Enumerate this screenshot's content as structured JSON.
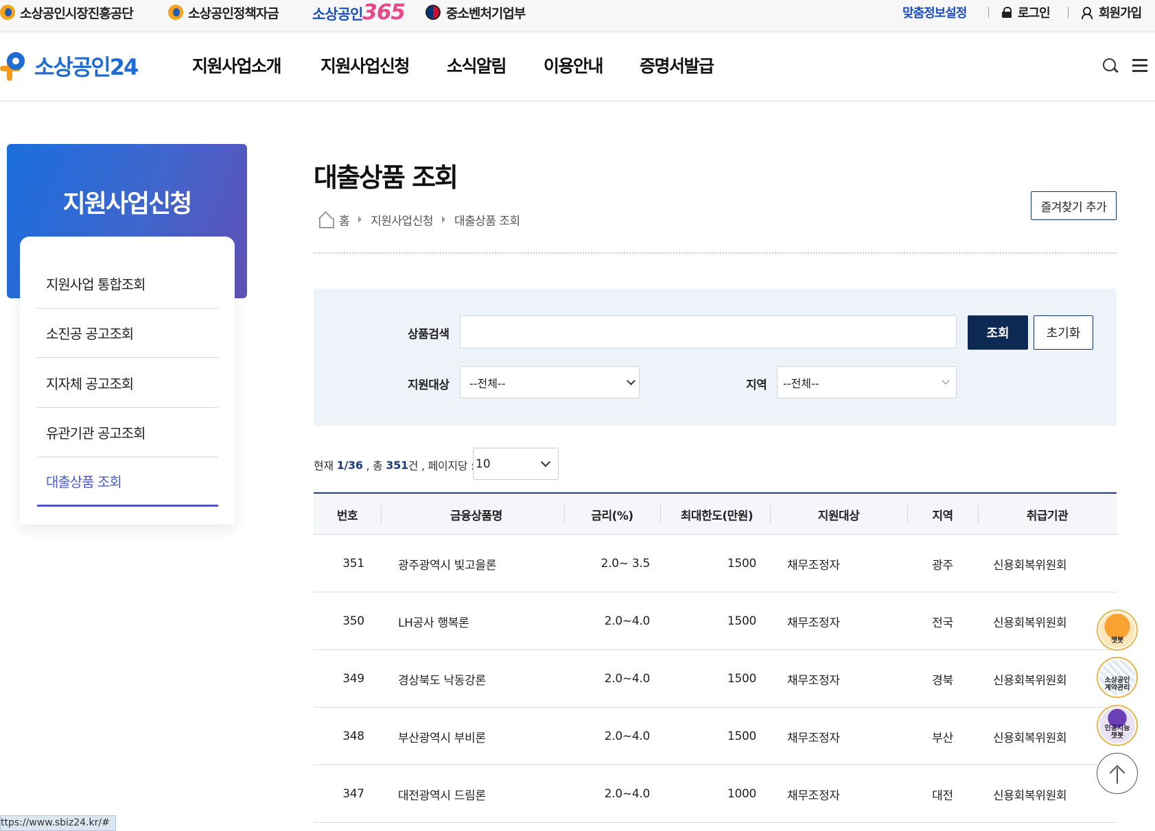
{
  "topbar": {
    "org1": "소상공인시장진흥공단",
    "org2": "소상공인정책자금",
    "org3_text": "소상공인",
    "org3_num": "365",
    "org4": "중소벤처기업부",
    "custom_info": "맞춤정보설정",
    "login": "로그인",
    "signup": "회원가입"
  },
  "header": {
    "brand": "소상공인24",
    "nav": [
      "지원사업소개",
      "지원사업신청",
      "소식알림",
      "이용안내",
      "증명서발급"
    ]
  },
  "sidebar": {
    "title": "지원사업신청",
    "items": [
      "지원사업 통합조회",
      "소진공 공고조회",
      "지자체 공고조회",
      "유관기관 공고조회",
      "대출상품 조회"
    ],
    "active_index": 4
  },
  "page": {
    "title": "대출상품 조회",
    "breadcrumb": [
      "홈",
      "지원사업신청",
      "대출상품 조회"
    ],
    "favorite_button": "즐겨찾기 추가"
  },
  "search": {
    "product_label": "상품검색",
    "product_value": "",
    "search_button": "조회",
    "reset_button": "초기화",
    "target_label": "지원대상",
    "target_value": "--전체--",
    "region_label": "지역",
    "region_value": "--전체--"
  },
  "summary": {
    "current_label": "현재",
    "page": "1/36",
    "total_label": ", 총",
    "total": "351",
    "unit": "건",
    "per_page_label": ", 페이지당 :",
    "per_page": "10"
  },
  "table": {
    "headers": [
      "번호",
      "금융상품명",
      "금리(%)",
      "최대한도(만원)",
      "지원대상",
      "지역",
      "취급기관"
    ],
    "rows": [
      {
        "no": "351",
        "name": "광주광역시 빛고을론",
        "rate": "2.0~ 3.5",
        "limit": "1500",
        "target": "채무조정자",
        "region": "광주",
        "agency": "신용회복위원회"
      },
      {
        "no": "350",
        "name": "LH공사 행복론",
        "rate": "2.0~4.0",
        "limit": "1500",
        "target": "채무조정자",
        "region": "전국",
        "agency": "신용회복위원회"
      },
      {
        "no": "349",
        "name": "경상북도 낙동강론",
        "rate": "2.0~4.0",
        "limit": "1500",
        "target": "채무조정자",
        "region": "경북",
        "agency": "신용회복위원회"
      },
      {
        "no": "348",
        "name": "부산광역시 부비론",
        "rate": "2.0~4.0",
        "limit": "1500",
        "target": "채무조정자",
        "region": "부산",
        "agency": "신용회복위원회"
      },
      {
        "no": "347",
        "name": "대전광역시 드림론",
        "rate": "2.0~4.0",
        "limit": "1000",
        "target": "채무조정자",
        "region": "대전",
        "agency": "신용회복위원회"
      }
    ]
  },
  "floating": {
    "chatbot": "챗봇",
    "contract": "소상공인 계약관리",
    "ai_chatbot": "인공지능 챗봇"
  },
  "status_bar": "ttps://www.sbiz24.kr/#",
  "colors": {
    "brand_blue": "#1e6bd6",
    "navy": "#0d2a55",
    "accent_orange": "#f59a1b",
    "active_menu": "#4a5cc8"
  }
}
